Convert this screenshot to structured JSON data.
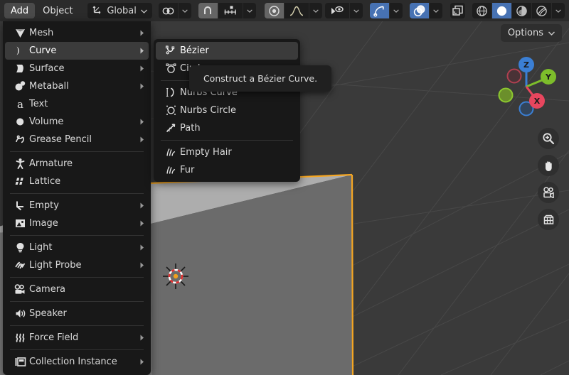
{
  "header": {
    "menus": [
      {
        "label": "Add",
        "active": true,
        "name": "menu-add"
      },
      {
        "label": "Object",
        "active": false,
        "name": "menu-object"
      }
    ],
    "transform_orientation": {
      "icon": "orientation-axis-icon",
      "value": "Global",
      "chevron": "chevron-down-icon"
    },
    "pivot_point": {
      "icon": "pivot-point-icon",
      "chevron": "chevron-down-icon"
    },
    "snapping": {
      "magnet_icon": "magnet-icon",
      "magnet_on": true,
      "snap_to_icon": "snap-increment-icon",
      "chevron": "chevron-down-icon"
    },
    "proportional_editing": {
      "icon": "proportional-edit-icon",
      "on": true,
      "falloff_icon": "smooth-falloff-curve-icon",
      "chevron": "chevron-down-icon"
    },
    "visibility": {
      "icon": "object-visibility-icon",
      "chevron": "chevron-down-icon"
    },
    "gizmos": {
      "icon": "gizmo-icon",
      "on": true,
      "chevron": "chevron-down-icon"
    },
    "overlays": {
      "icon": "overlays-icon",
      "on": true,
      "chevron": "chevron-down-icon"
    },
    "xray": {
      "icon": "xray-toggle-icon",
      "on": false
    },
    "shading": {
      "modes": [
        {
          "name": "shading-wireframe",
          "icon": "wireframe-sphere-icon",
          "active": false
        },
        {
          "name": "shading-solid",
          "icon": "solid-sphere-icon",
          "active": true
        },
        {
          "name": "shading-material",
          "icon": "material-preview-sphere-icon",
          "active": false
        },
        {
          "name": "shading-rendered",
          "icon": "rendered-sphere-icon",
          "active": false
        }
      ],
      "chevron": "chevron-down-icon"
    }
  },
  "viewport": {
    "options_button": {
      "label": "Options",
      "chevron": "chevron-down-icon"
    },
    "gizmo": {
      "axes": [
        {
          "label": "Z",
          "color": "#3b7fd4"
        },
        {
          "label": "Y",
          "color": "#7dbd2b"
        },
        {
          "label": "X",
          "color": "#e8465e"
        }
      ]
    },
    "nav_buttons": [
      {
        "name": "zoom-view-button",
        "icon": "zoom-in-icon"
      },
      {
        "name": "pan-view-button",
        "icon": "hand-icon"
      },
      {
        "name": "camera-view-button",
        "icon": "camera-icon"
      },
      {
        "name": "toggle-perspective-button",
        "icon": "orthographic-grid-icon"
      }
    ],
    "cursor_3d": "cursor-3d-icon",
    "selected_object_outline_color": "#f5a623"
  },
  "add_menu": {
    "groups": [
      {
        "items": [
          {
            "label": "Mesh",
            "icon": "mesh-cone-icon",
            "submenu": true,
            "highlight": false
          },
          {
            "label": "Curve",
            "icon": "curve-icon",
            "submenu": true,
            "highlight": true
          },
          {
            "label": "Surface",
            "icon": "surface-icon",
            "submenu": true,
            "highlight": false
          },
          {
            "label": "Metaball",
            "icon": "metaball-icon",
            "submenu": true,
            "highlight": false
          },
          {
            "label": "Text",
            "icon": "text-a-icon",
            "submenu": false,
            "highlight": false
          },
          {
            "label": "Volume",
            "icon": "volume-icon",
            "submenu": true,
            "highlight": false
          },
          {
            "label": "Grease Pencil",
            "icon": "grease-pencil-icon",
            "submenu": true,
            "highlight": false
          }
        ]
      },
      {
        "items": [
          {
            "label": "Armature",
            "icon": "armature-icon",
            "submenu": false,
            "highlight": false
          },
          {
            "label": "Lattice",
            "icon": "lattice-icon",
            "submenu": false,
            "highlight": false
          }
        ]
      },
      {
        "items": [
          {
            "label": "Empty",
            "icon": "empty-axes-icon",
            "submenu": true,
            "highlight": false
          },
          {
            "label": "Image",
            "icon": "image-icon",
            "submenu": true,
            "highlight": false
          }
        ]
      },
      {
        "items": [
          {
            "label": "Light",
            "icon": "light-bulb-icon",
            "submenu": true,
            "highlight": false
          },
          {
            "label": "Light Probe",
            "icon": "light-probe-icon",
            "submenu": true,
            "highlight": false
          }
        ]
      },
      {
        "items": [
          {
            "label": "Camera",
            "icon": "camera-icon",
            "submenu": false,
            "highlight": false
          }
        ]
      },
      {
        "items": [
          {
            "label": "Speaker",
            "icon": "speaker-icon",
            "submenu": false,
            "highlight": false
          }
        ]
      },
      {
        "items": [
          {
            "label": "Force Field",
            "icon": "force-field-icon",
            "submenu": true,
            "highlight": false
          }
        ]
      },
      {
        "items": [
          {
            "label": "Collection Instance",
            "icon": "collection-instance-icon",
            "submenu": true,
            "highlight": false
          }
        ]
      }
    ]
  },
  "curve_submenu": {
    "groups": [
      {
        "items": [
          {
            "label": "Bézier",
            "icon": "bezier-curve-icon",
            "highlight": true
          },
          {
            "label": "Circle",
            "icon": "bezier-circle-icon",
            "highlight": false
          }
        ]
      },
      {
        "items": [
          {
            "label": "Nurbs Curve",
            "icon": "nurbs-curve-icon",
            "highlight": false
          },
          {
            "label": "Nurbs Circle",
            "icon": "nurbs-circle-icon",
            "highlight": false
          },
          {
            "label": "Path",
            "icon": "path-icon",
            "highlight": false
          }
        ]
      },
      {
        "items": [
          {
            "label": "Empty Hair",
            "icon": "hair-icon",
            "highlight": false
          },
          {
            "label": "Fur",
            "icon": "fur-icon",
            "highlight": false
          }
        ]
      }
    ]
  },
  "tooltip": {
    "text": "Construct a Bézier Curve."
  }
}
